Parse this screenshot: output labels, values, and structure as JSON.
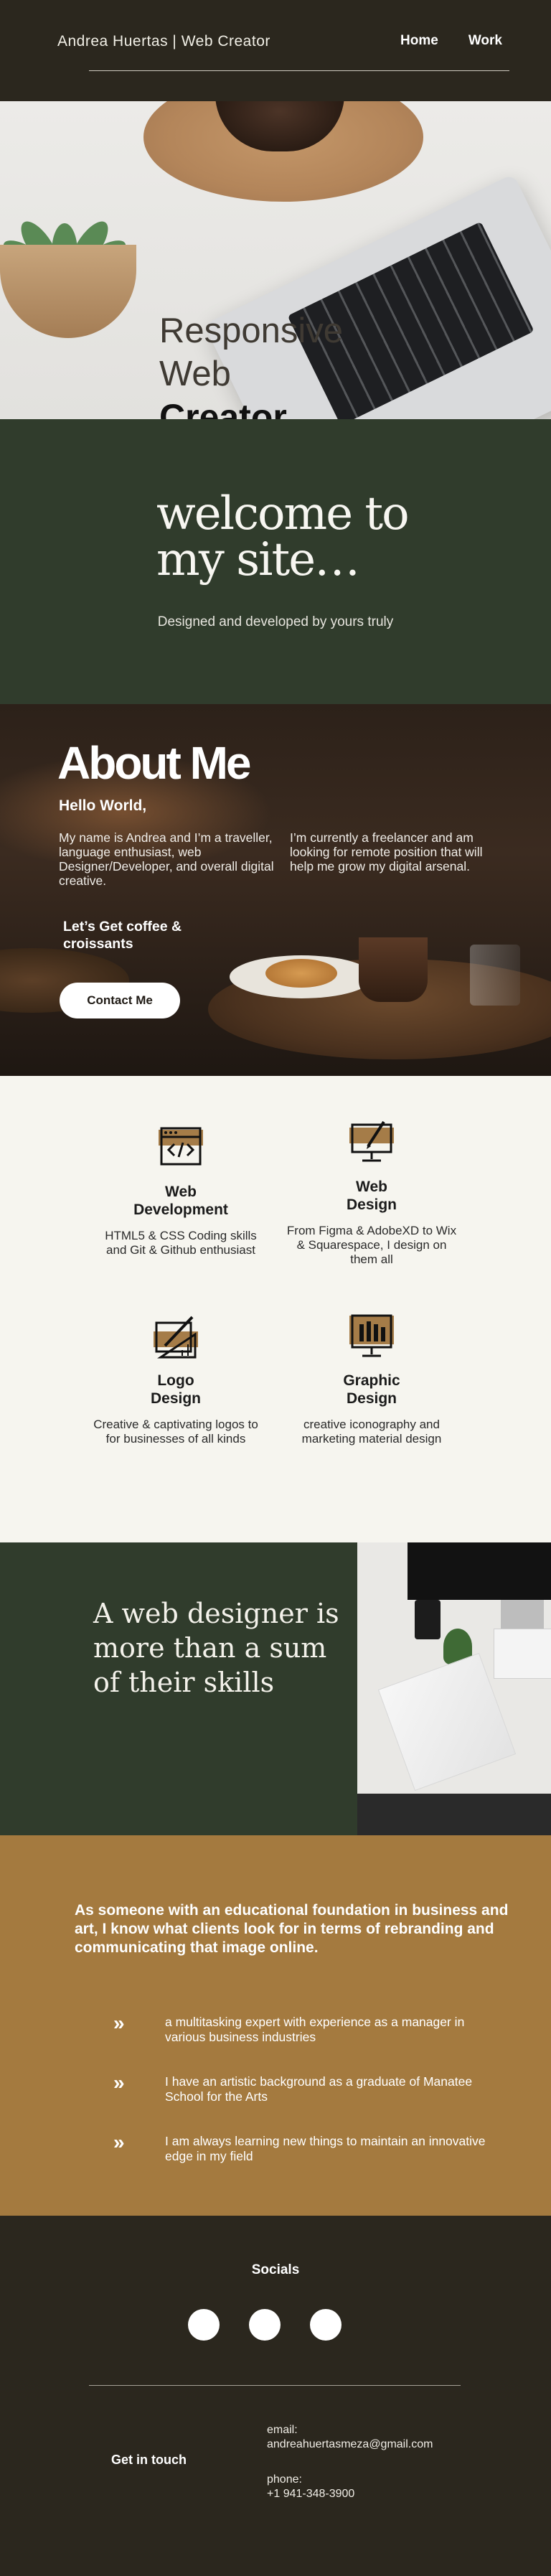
{
  "header": {
    "brand": "Andrea Huertas | Web Creator",
    "nav": [
      {
        "label": "Home"
      },
      {
        "label": "Work"
      }
    ]
  },
  "hero": {
    "line1": "Responsive",
    "line2": "Web",
    "line3": "Creator"
  },
  "welcome": {
    "title_line1": "welcome to",
    "title_line2": "my site…",
    "subtitle": "Designed and developed by yours truly"
  },
  "about": {
    "title": "About Me",
    "greeting": "Hello World,",
    "col1": "My name is Andrea and I’m a traveller, language enthusiast, web Designer/Developer, and overall digital creative.",
    "col2": "I’m currently a freelancer and am looking for remote position that will help me grow my digital arsenal.",
    "coffee_line1": "Let’s Get coffee &",
    "coffee_line2": "croissants",
    "contact_button": "Contact Me"
  },
  "services": [
    {
      "title_line1": "Web",
      "title_line2": "Development",
      "icon": "code-window-icon",
      "desc": "HTML5 & CSS Coding skills and Git & Github enthusiast"
    },
    {
      "title_line1": "Web",
      "title_line2": "Design",
      "icon": "monitor-pen-icon",
      "desc": "From Figma & AdobeXD to Wix & Squarespace, I design on them all"
    },
    {
      "title_line1": "Logo",
      "title_line2": "Design",
      "icon": "logo-ruler-pen-icon",
      "desc": "Creative & captivating logos to for businesses of all kinds"
    },
    {
      "title_line1": "Graphic",
      "title_line2": "Design",
      "icon": "monitor-pencils-icon",
      "desc": "creative iconography and marketing material design"
    }
  ],
  "skills": {
    "quote": "A web designer is more than a sum of their skills"
  },
  "highlights": {
    "lead": "As someone with an educational foundation in business and art, I know what clients look for in terms of rebranding and communicating that image online.",
    "items": [
      "a multitasking expert with experience as a manager in various business industries",
      "I have an artistic background as a graduate of Manatee School for the Arts",
      "I am always learning new things to maintain an innovative edge in my field"
    ],
    "bullet_icon": "double-chevron-right-icon",
    "bullet_glyph": "»"
  },
  "footer": {
    "socials_title": "Socials",
    "get_in_touch": "Get in touch",
    "email_label": "email:",
    "email": "andreahuertasmeza@gmail.com",
    "phone_label": "phone:",
    "phone": "+1 941-348-3900"
  },
  "colors": {
    "dark_brown": "#2b271e",
    "forest_green": "#303c2c",
    "tan": "#a47a3f",
    "off_white": "#f6f5ef"
  }
}
